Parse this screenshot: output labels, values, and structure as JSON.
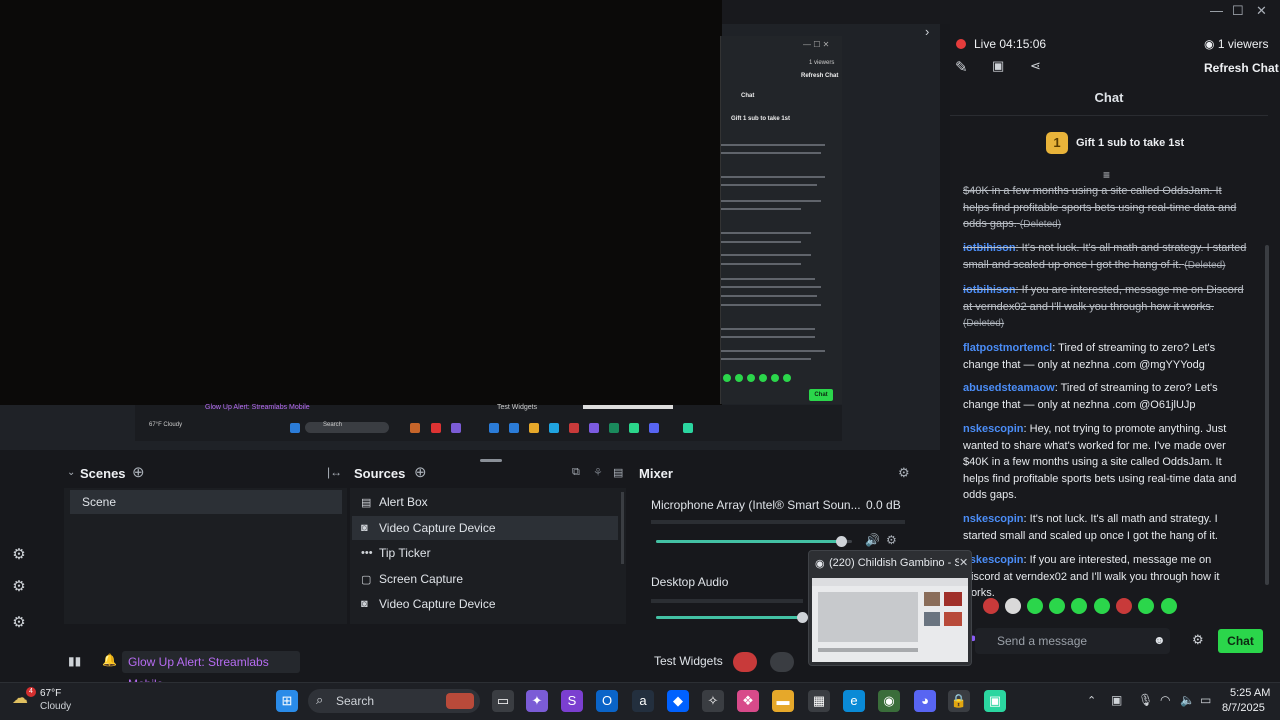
{
  "window": {
    "minimize": "—",
    "maximize": "☐",
    "close": "✕"
  },
  "chat_header": {
    "live_label": "Live",
    "timer": "04:15:06",
    "viewers": "1 viewers",
    "refresh": "Refresh Chat",
    "title": "Chat"
  },
  "gift": {
    "badge": "1",
    "text": "Gift 1 sub to take 1st"
  },
  "messages": [
    {
      "user": "",
      "text": "$40K in a few months using a site called OddsJam. It helps find profitable sports bets using real-time data and odds gaps.",
      "tag": "(Deleted)",
      "deleted": true
    },
    {
      "user": "iotbihison",
      "text": ": It's not luck. It's all math and strategy. I started small and scaled up once I got the hang of it.",
      "tag": "(Deleted)",
      "deleted": true
    },
    {
      "user": "iotbihison",
      "text": ": If you are interested, message me on Discord at verndex02 and I'll walk you through how it works.",
      "tag": "(Deleted)",
      "deleted": true
    },
    {
      "user": "flatpostmortemcl",
      "text": ": Tired of streaming to zero? Let's change that — only at nezhna .com @mgYYYodg",
      "tag": "",
      "deleted": false
    },
    {
      "user": "abusedsteamaow",
      "text": ": Tired of streaming to zero? Let's change that — only at nezhna .com @O61jlUJp",
      "tag": "",
      "deleted": false
    },
    {
      "user": "nskescopin",
      "text": ": Hey, not trying to promote anything. Just wanted to share what's worked for me. I've made over $40K in a few months using a site called OddsJam. It helps find profitable sports bets using real-time data and odds gaps.",
      "tag": "",
      "deleted": false
    },
    {
      "user": "nskescopin",
      "text": ": It's not luck. It's all math and strategy. I started small and scaled up once I got the hang of it.",
      "tag": "",
      "deleted": false
    },
    {
      "user": "nskescopin",
      "text": ": If you are interested, message me on Discord at verndex02 and I'll walk you through how it works.",
      "tag": "",
      "deleted": false
    }
  ],
  "chat_input": {
    "placeholder": "Send a message",
    "send": "Chat"
  },
  "scenes": {
    "title": "Scenes",
    "items": [
      "Scene"
    ]
  },
  "sources": {
    "title": "Sources",
    "items": [
      "Alert Box",
      "Video Capture Device",
      "Tip Ticker",
      "Screen Capture",
      "Video Capture Device"
    ]
  },
  "mixer": {
    "title": "Mixer",
    "channels": [
      {
        "name": "Microphone Array (Intel® Smart Soun...",
        "db": "0.0 dB",
        "level": 0.95
      },
      {
        "name": "Desktop Audio",
        "db": "",
        "level": 0.98
      }
    ]
  },
  "statusbar": {
    "alert": "Glow Up Alert: Streamlabs Mobile",
    "test_widgets": "Test Widgets"
  },
  "thumbnail": {
    "title": "(220) Childish Gambino - S..."
  },
  "taskbar": {
    "weather_temp": "67°F",
    "weather_cond": "Cloudy",
    "weather_badge": "4",
    "search": "Search",
    "time": "5:25 AM",
    "date": "8/7/2025"
  },
  "nested": {
    "viewers": "1 viewers",
    "refresh": "Refresh Chat",
    "chat": "Chat",
    "gift": "Gift 1 sub to take 1st",
    "alert": "Glow Up Alert: Streamlabs Mobile",
    "test_widgets": "Test Widgets",
    "weather": "67°F Cloudy",
    "search": "Search",
    "send": "Chat"
  }
}
